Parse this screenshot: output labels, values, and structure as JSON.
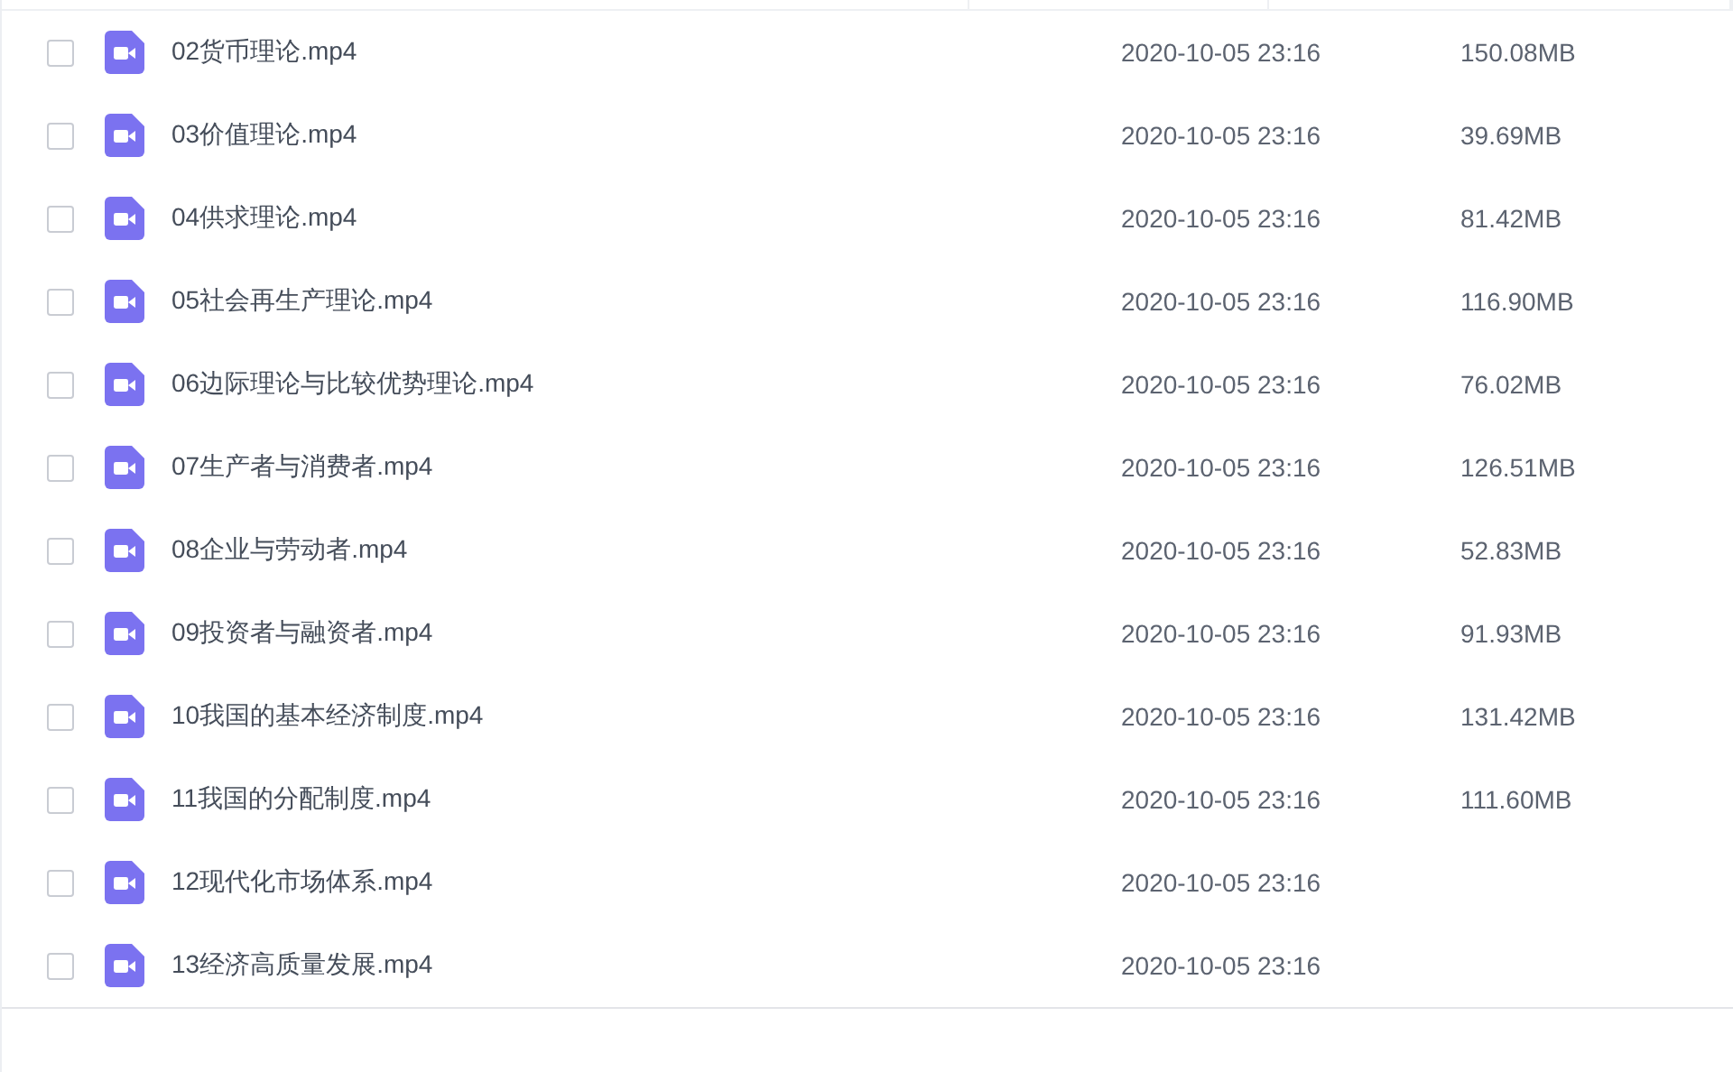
{
  "files": [
    {
      "name": "02货币理论.mp4",
      "date": "2020-10-05 23:16",
      "size": "150.08MB",
      "checked": false
    },
    {
      "name": "03价值理论.mp4",
      "date": "2020-10-05 23:16",
      "size": "39.69MB",
      "checked": false
    },
    {
      "name": "04供求理论.mp4",
      "date": "2020-10-05 23:16",
      "size": "81.42MB",
      "checked": false
    },
    {
      "name": "05社会再生产理论.mp4",
      "date": "2020-10-05 23:16",
      "size": "116.90MB",
      "checked": false
    },
    {
      "name": "06边际理论与比较优势理论.mp4",
      "date": "2020-10-05 23:16",
      "size": "76.02MB",
      "checked": false
    },
    {
      "name": "07生产者与消费者.mp4",
      "date": "2020-10-05 23:16",
      "size": "126.51MB",
      "checked": false
    },
    {
      "name": "08企业与劳动者.mp4",
      "date": "2020-10-05 23:16",
      "size": "52.83MB",
      "checked": false
    },
    {
      "name": "09投资者与融资者.mp4",
      "date": "2020-10-05 23:16",
      "size": "91.93MB",
      "checked": false
    },
    {
      "name": "10我国的基本经济制度.mp4",
      "date": "2020-10-05 23:16",
      "size": "131.42MB",
      "checked": false
    },
    {
      "name": "11我国的分配制度.mp4",
      "date": "2020-10-05 23:16",
      "size": "111.60MB",
      "checked": false
    },
    {
      "name": "12现代化市场体系.mp4",
      "date": "2020-10-05 23:16",
      "checked": false
    },
    {
      "name": "13经济高质量发展.mp4",
      "date": "2020-10-05 23:16",
      "checked": false
    }
  ]
}
